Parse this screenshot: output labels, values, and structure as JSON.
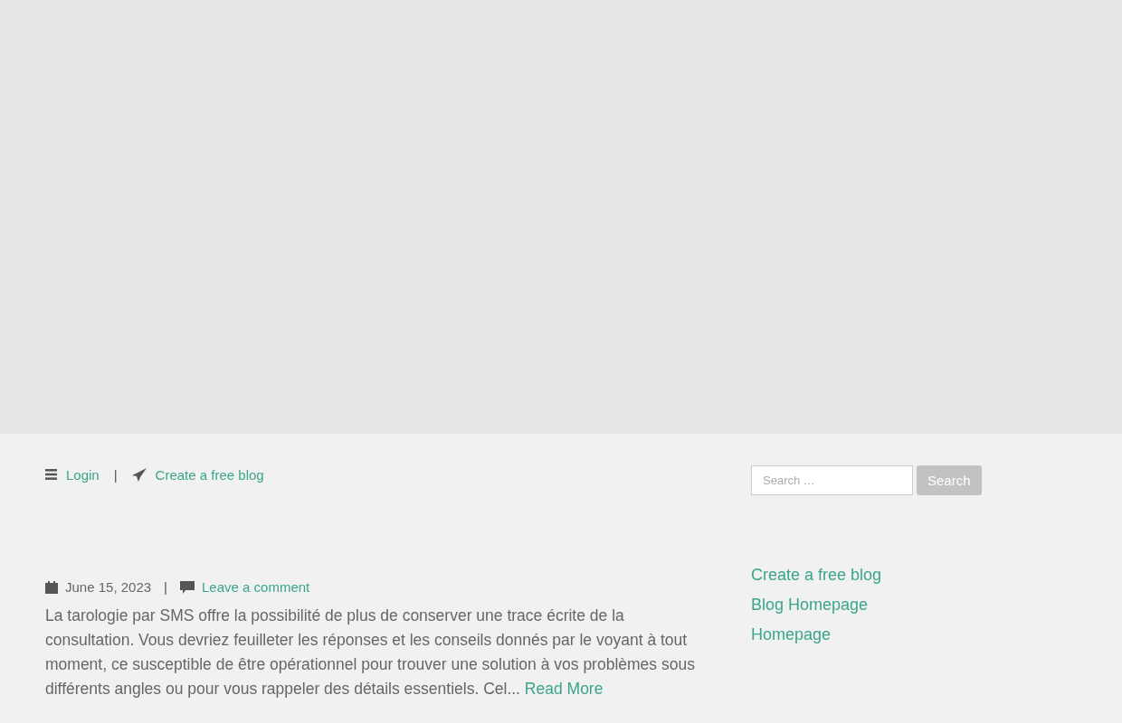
{
  "topbar": {
    "separator": "|",
    "links": [
      {
        "kind": "menu",
        "label": "Login"
      },
      {
        "kind": "send",
        "label": "Create a free blog"
      }
    ]
  },
  "post": {
    "date": "June 15, 2023",
    "separator": "|",
    "comment_link": "Leave a comment",
    "excerpt": "La tarologie par SMS offre la possibilité de plus de conserver une trace écrite de la consultation. Vous devriez feuilleter les réponses et les conseils donnés par le voyant à tout moment, ce susceptible de être opérationnel pour trouver une solution à vos problèmes sous différents angles ou pour vous rappeler des détails essentiels. Cel...",
    "read_more": "Read More"
  },
  "sidebar": {
    "search": {
      "placeholder": "Search …",
      "button": "Search"
    },
    "links": [
      "Create a free blog",
      "Blog Homepage",
      "Homepage"
    ]
  }
}
